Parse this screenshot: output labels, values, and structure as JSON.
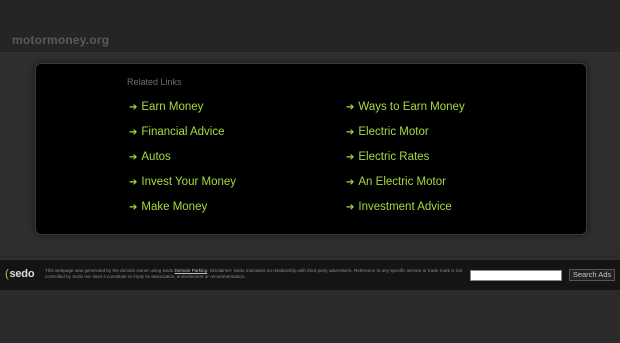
{
  "header": {
    "domain": "motormoney.org"
  },
  "panel": {
    "title": "Related Links",
    "arrow": "➔",
    "left_links": [
      "Earn Money",
      "Financial Advice",
      "Autos",
      "Invest Your Money",
      "Make Money"
    ],
    "right_links": [
      "Ways to Earn Money",
      "Electric Motor",
      "Electric Rates",
      "An Electric Motor",
      "Investment Advice"
    ]
  },
  "footer": {
    "logo": "sedo",
    "disclaimer_pre": "This webpage was generated by the domain owner using Sedo ",
    "disclaimer_link": "Domain Parking",
    "disclaimer_post": ". Disclaimer: Sedo maintains no relationship with third party advertisers. Reference to any specific service or trade mark is not controlled by Sedo nor does it constitute or imply its association, endorsement or recommendation.",
    "search_button": "Search Ads"
  },
  "colors": {
    "link": "#a6d940",
    "panel_bg": "#000000",
    "page_bg": "#2b2b2b"
  }
}
